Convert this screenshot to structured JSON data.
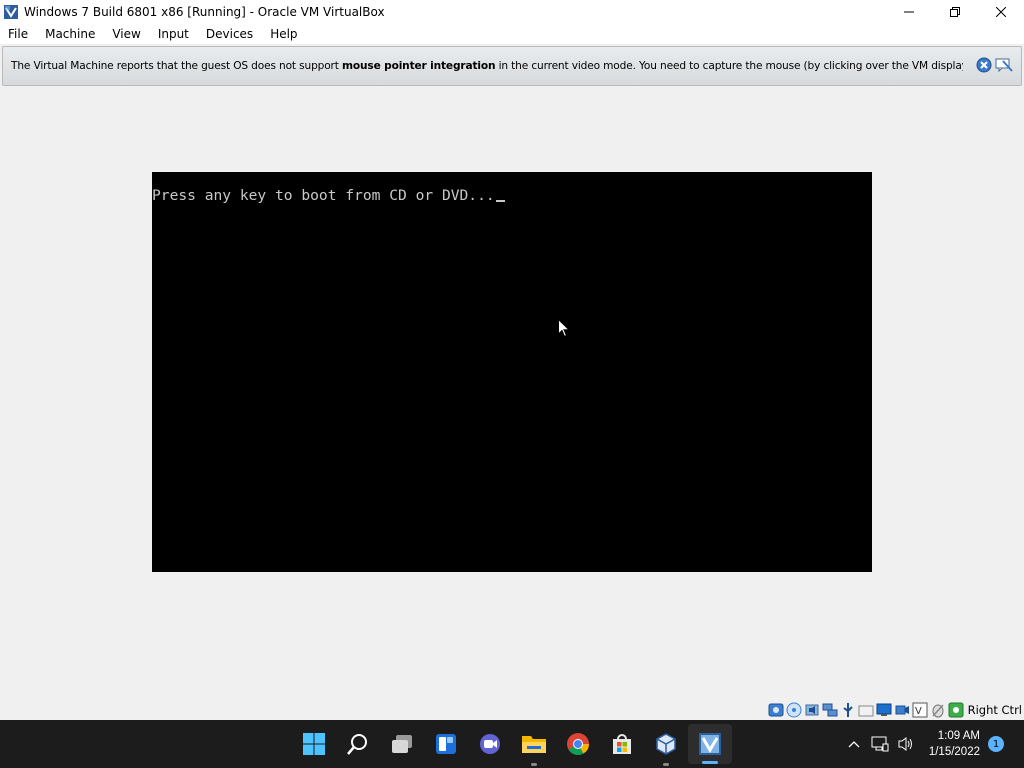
{
  "window": {
    "title": "Windows 7 Build 6801 x86 [Running] - Oracle VM VirtualBox",
    "icon": "virtualbox-icon"
  },
  "menu": {
    "items": [
      {
        "label": "File"
      },
      {
        "label": "Machine"
      },
      {
        "label": "View"
      },
      {
        "label": "Input"
      },
      {
        "label": "Devices"
      },
      {
        "label": "Help"
      }
    ]
  },
  "banner": {
    "text_before": "The Virtual Machine reports that the guest OS does not support ",
    "text_bold": "mouse pointer integration",
    "text_after": " in the current video mode. You need to capture the mouse (by clicking over the VM display or pressing"
  },
  "vm_display": {
    "console_text": "Press any key to boot from CD or DVD..."
  },
  "statusbar": {
    "icons": [
      "hard-disk-icon",
      "optical-drive-icon",
      "audio-icon",
      "network-icon",
      "usb-icon",
      "shared-folders-icon",
      "display-icon",
      "recording-icon",
      "virtualization-icon",
      "mouse-integration-icon",
      "host-key-icon"
    ],
    "host_key_label": "Right Ctrl"
  },
  "taskbar": {
    "apps": [
      {
        "name": "start-button"
      },
      {
        "name": "search-button"
      },
      {
        "name": "task-view-button"
      },
      {
        "name": "widgets-button"
      },
      {
        "name": "chat-button"
      },
      {
        "name": "file-explorer-button"
      },
      {
        "name": "chrome-button"
      },
      {
        "name": "store-button"
      },
      {
        "name": "virtualbox-manager-button"
      },
      {
        "name": "virtualbox-vm-button"
      }
    ],
    "clock": {
      "time": "1:09 AM",
      "date": "1/15/2022"
    },
    "notification_count": "1"
  },
  "colors": {
    "accent": "#5bb2ff",
    "taskbar_bg": "#1c1c1c",
    "vm_bg": "#000000",
    "console_text": "#c8c8c8"
  }
}
